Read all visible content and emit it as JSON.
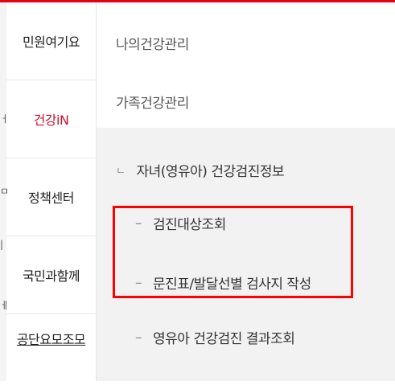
{
  "left_nav": {
    "items": [
      {
        "label": "민원여기요"
      },
      {
        "label": "건강iN"
      },
      {
        "label": "정책센터"
      },
      {
        "label": "국민과함께"
      },
      {
        "label": "공단요모조모"
      }
    ]
  },
  "right_menu": {
    "items": [
      {
        "label": "나의건강관리"
      },
      {
        "label": "가족건강관리"
      }
    ],
    "submenu": {
      "title": "자녀(영유아) 건강검진정보",
      "title_marker": "ㄴ",
      "dash": "–",
      "children": [
        {
          "label": "검진대상조회"
        },
        {
          "label": "문진표/발달선별 검사지 작성"
        },
        {
          "label": "영유아 건강검진 결과조회"
        }
      ]
    }
  },
  "colors": {
    "accent": "#e60012",
    "active_text": "#c8102e",
    "highlight_box": "#ff0000"
  }
}
